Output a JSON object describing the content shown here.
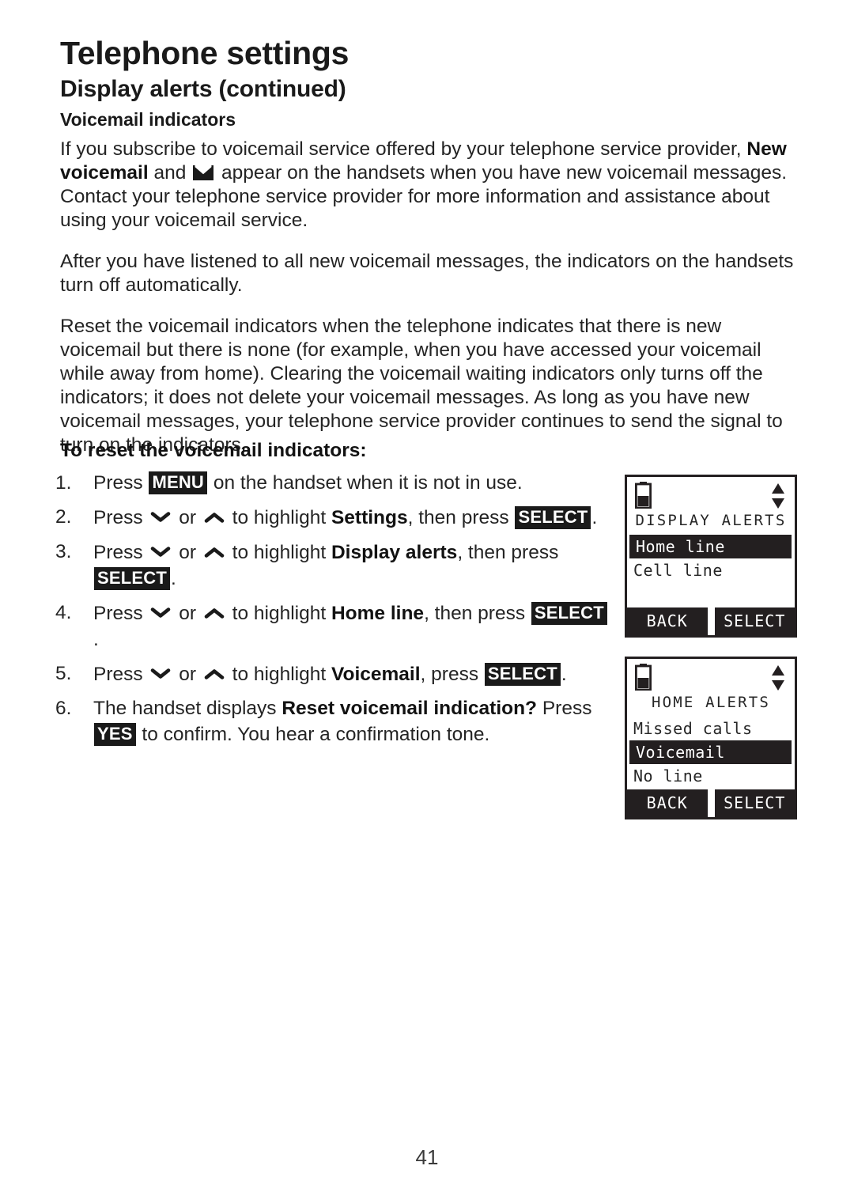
{
  "document": {
    "chapter_title": "Telephone settings",
    "section_title": "Display alerts (continued)",
    "subsection_title": "Voicemail indicators",
    "page_number": "41"
  },
  "paragraphs": {
    "p1_a": "If you subscribe to voicemail service offered by your telephone service provider, ",
    "p1_bold": "New voicemail",
    "p1_b": " and ",
    "p1_c": " appear on the handsets when you have new voicemail messages. Contact your telephone service provider for more information and assistance about using your voicemail service.",
    "p2": "After you have listened to all new voicemail messages, the indicators on the handsets turn off automatically.",
    "p3": "Reset the voicemail indicators when the telephone indicates that there is new voicemail but there is none (for example, when you have accessed your voicemail while away from home). Clearing the voicemail waiting indicators only turns off the indicators; it does not delete your voicemail messages. As long as you have new voicemail messages, your telephone service provider continues to send the signal to turn on the indicators."
  },
  "procedure": {
    "title": "To reset the voicemail indicators:",
    "steps": [
      {
        "num": "1.",
        "t1": "Press ",
        "key1": "MENU",
        "t2": " on the handset when it is not in use."
      },
      {
        "num": "2.",
        "t1": "Press ",
        "t2": " or ",
        "t3": " to highlight ",
        "bold1": "Settings",
        "t4": ", then press ",
        "key1": "SELECT",
        "t5": "."
      },
      {
        "num": "3.",
        "t1": "Press ",
        "t2": " or ",
        "t3": " to highlight ",
        "bold1": "Display alerts",
        "t4": ", then press ",
        "key1": "SELECT",
        "t5": "."
      },
      {
        "num": "4.",
        "t1": "Press ",
        "t2": " or ",
        "t3": " to highlight ",
        "bold1": "Home line",
        "t4": ", then press ",
        "key1": "SELECT",
        "t5": "."
      },
      {
        "num": "5.",
        "t1": "Press ",
        "t2": " or ",
        "t3": " to highlight ",
        "bold1": "Voicemail",
        "t4": ", press ",
        "key1": "SELECT",
        "t5": "."
      },
      {
        "num": "6.",
        "t1": "The handset displays ",
        "bold1": "Reset voicemail indication?",
        "t2": " Press ",
        "key1": "YES",
        "t3": " to confirm. You hear a confirmation tone."
      }
    ]
  },
  "screens": [
    {
      "title": "DISPLAY ALERTS",
      "rows": [
        {
          "label": "Home line",
          "selected": true
        },
        {
          "label": "Cell line",
          "selected": false
        }
      ],
      "softkey_left": "BACK",
      "softkey_right": "SELECT"
    },
    {
      "title": "HOME ALERTS",
      "rows": [
        {
          "label": "Missed calls",
          "selected": false
        },
        {
          "label": "Voicemail",
          "selected": true
        },
        {
          "label": "No line",
          "selected": false
        }
      ],
      "softkey_left": "BACK",
      "softkey_right": "SELECT"
    }
  ],
  "colors": {
    "ink": "#231f20",
    "paper": "#ffffff"
  }
}
